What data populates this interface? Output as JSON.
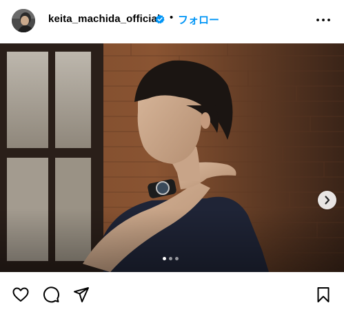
{
  "post": {
    "username": "keita_machida_official",
    "separator": "•",
    "follow_label": "フォロー",
    "verified": true,
    "accent_color": "#0095f6",
    "verified_color": "#0095f6"
  },
  "carousel": {
    "slide_count": 3,
    "active_index": 0
  },
  "icons": {
    "header": [
      "verified-badge-icon",
      "more-options-icon"
    ],
    "media": [
      "chevron-right-icon"
    ],
    "actions": [
      "heart-icon",
      "comment-icon",
      "share-icon",
      "bookmark-icon"
    ]
  }
}
